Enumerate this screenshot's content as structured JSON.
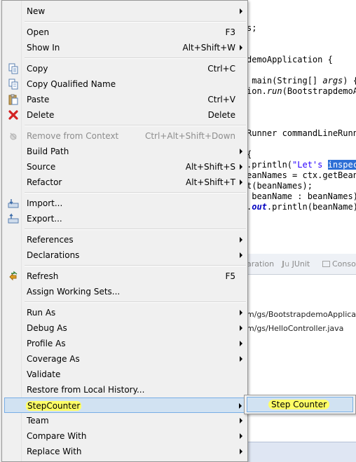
{
  "editor": {
    "code_lines": [
      {
        "tokens": [
          {
            "t": "s;"
          }
        ]
      },
      {
        "tokens": [
          {
            "t": "demoApplication {"
          }
        ]
      },
      {
        "tokens": [
          {
            "t": " main(String[] "
          },
          {
            "t": "args",
            "c": "it"
          },
          {
            "t": ") {"
          }
        ]
      },
      {
        "tokens": [
          {
            "t": "ion."
          },
          {
            "t": "run",
            "c": "it"
          },
          {
            "t": "(BootstrapdemoAp"
          }
        ]
      },
      {
        "tokens": [
          {
            "t": "Runner commandLineRunne"
          }
        ]
      },
      {
        "tokens": [
          {
            "t": "{"
          }
        ]
      },
      {
        "tokens": [
          {
            "t": ".println("
          },
          {
            "t": "\"Let's ",
            "c": "str"
          },
          {
            "t": "inspect",
            "c": "hl"
          }
        ]
      },
      {
        "tokens": [
          {
            "t": "eanNames = ctx.getBeanD"
          }
        ]
      },
      {
        "tokens": [
          {
            "t": "t(beanNames);"
          }
        ]
      },
      {
        "tokens": [
          {
            "t": " beanName : beanNames)"
          }
        ]
      },
      {
        "tokens": [
          {
            "t": "."
          },
          {
            "t": "out",
            "c": "fld"
          },
          {
            "t": ".println(beanName);"
          }
        ]
      }
    ],
    "panel_tabs": [
      "aration",
      "JUnit",
      "Conso"
    ],
    "panel_rows": [
      "m/gs/BootstrapdemoApplicat",
      "m/gs/HelloController.java"
    ]
  },
  "context_menu": {
    "items": [
      {
        "label": "New",
        "submenu": true
      },
      {
        "label": "Open",
        "accel": "F3"
      },
      {
        "label": "Show In",
        "accel": "Alt+Shift+W",
        "submenu": true
      },
      {
        "label": "Copy",
        "accel": "Ctrl+C",
        "icon": "copy-icon"
      },
      {
        "label": "Copy Qualified Name",
        "icon": "copy-qualified-name-icon"
      },
      {
        "label": "Paste",
        "accel": "Ctrl+V",
        "icon": "paste-icon"
      },
      {
        "label": "Delete",
        "accel": "Delete",
        "icon": "delete-icon"
      },
      {
        "label": "Remove from Context",
        "accel": "Ctrl+Alt+Shift+Down",
        "icon": "remove-context-icon",
        "disabled": true
      },
      {
        "label": "Build Path",
        "submenu": true
      },
      {
        "label": "Source",
        "accel": "Alt+Shift+S",
        "submenu": true
      },
      {
        "label": "Refactor",
        "accel": "Alt+Shift+T",
        "submenu": true
      },
      {
        "label": "Import...",
        "icon": "import-icon"
      },
      {
        "label": "Export...",
        "icon": "export-icon"
      },
      {
        "label": "References",
        "submenu": true
      },
      {
        "label": "Declarations",
        "submenu": true
      },
      {
        "label": "Refresh",
        "accel": "F5",
        "icon": "refresh-icon"
      },
      {
        "label": "Assign Working Sets..."
      },
      {
        "label": "Run As",
        "submenu": true
      },
      {
        "label": "Debug As",
        "submenu": true
      },
      {
        "label": "Profile As",
        "submenu": true
      },
      {
        "label": "Coverage As",
        "submenu": true
      },
      {
        "label": "Validate"
      },
      {
        "label": "Restore from Local History..."
      },
      {
        "label": "StepCounter",
        "submenu": true,
        "selected": true
      },
      {
        "label": "Team",
        "submenu": true
      },
      {
        "label": "Compare With",
        "submenu": true
      },
      {
        "label": "Replace With",
        "submenu": true
      }
    ]
  },
  "submenu": {
    "label": "Step Counter"
  },
  "colors": {
    "highlight_marker": "#ffff66",
    "selection_bg": "#d1e2f2",
    "selection_border": "#78aee5",
    "menu_bg": "#f0f0f0"
  }
}
